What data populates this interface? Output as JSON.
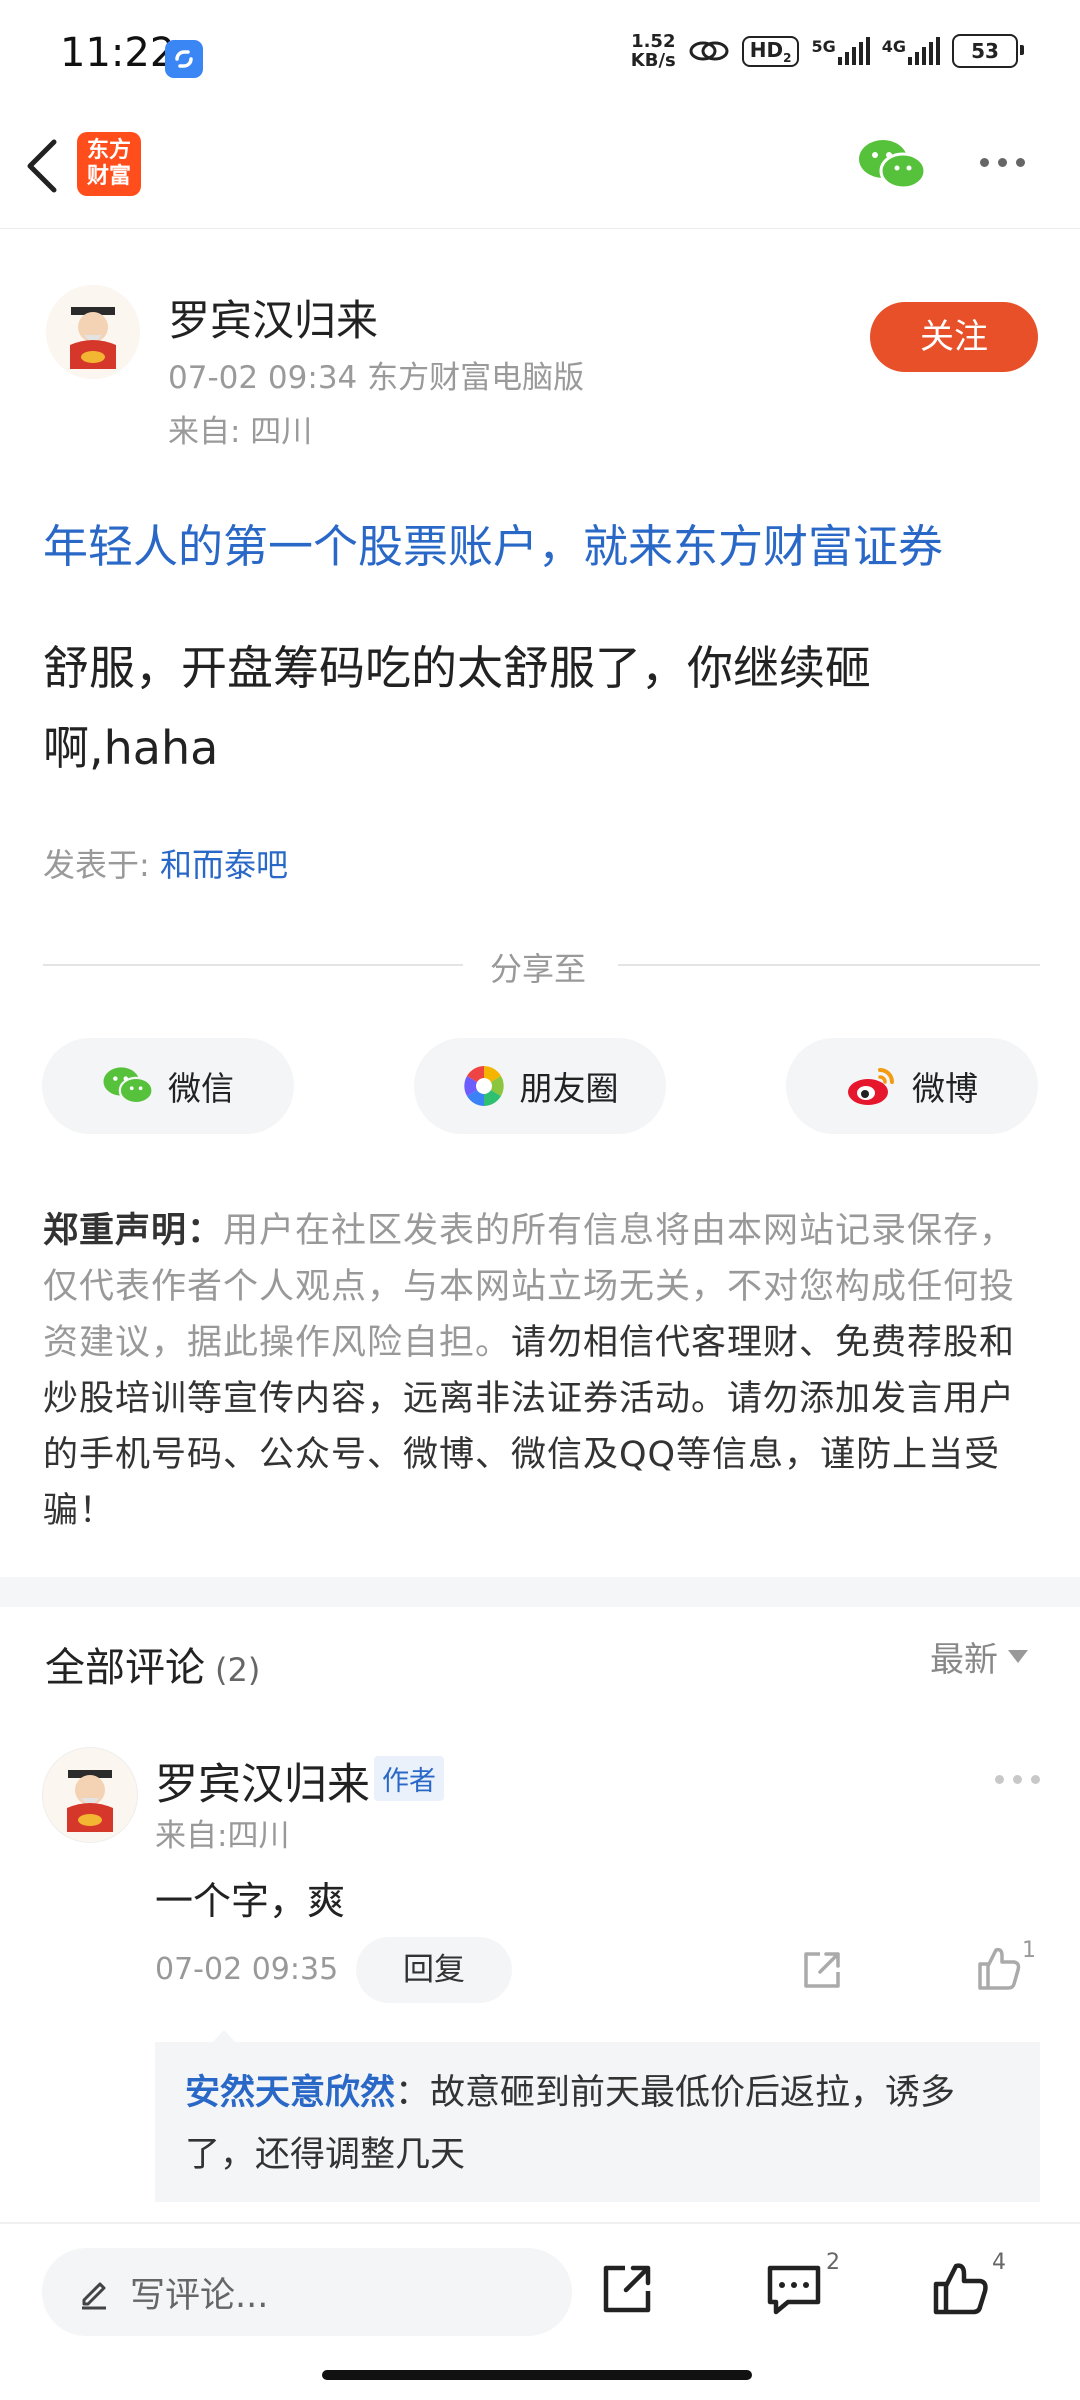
{
  "status_bar": {
    "time": "11:22",
    "net_speed_value": "1.52",
    "net_speed_unit": "KB/s",
    "hd_label": "HD",
    "hd_sub": "2",
    "signal_5g": "5G",
    "signal_4g": "4G",
    "battery": "53"
  },
  "nav": {
    "logo_line1": "东方",
    "logo_line2": "财富"
  },
  "post": {
    "author_name": "罗宾汉归来",
    "meta": "07-02 09:34 东方财富电脑版",
    "from": "来自: 四川",
    "follow_label": "关注",
    "ad_text": "年轻人的第一个股票账户，就来东方财富证券",
    "body_line1": "舒服，开盘筹码吃的太舒服了，你继续砸",
    "body_line2": "啊,haha",
    "posted_in_label": "发表于: ",
    "posted_in_link": "和而泰吧"
  },
  "share": {
    "label": "分享至",
    "wechat": "微信",
    "moments": "朋友圈",
    "weibo": "微博"
  },
  "disclaimer": {
    "title": "郑重声明：",
    "text": "用户在社区发表的所有信息将由本网站记录保存，仅代表作者个人观点，与本网站立场无关，不对您构成任何投资建议，据此操作风险自担。",
    "strong": "请勿相信代客理财、免费荐股和炒股培训等宣传内容，远离非法证券活动。请勿添加发言用户的手机号码、公众号、微博、微信及QQ等信息，谨防上当受骗！"
  },
  "comments": {
    "title": "全部评论",
    "count": "(2)",
    "sort": "最新",
    "items": [
      {
        "name": "罗宾汉归来",
        "tag": "作者",
        "from": "来自:四川",
        "text": "一个字，爽",
        "time": "07-02 09:35",
        "reply_label": "回复",
        "likes": "1",
        "reply": {
          "user": "安然天意欣然",
          "text": "：故意砸到前天最低价后返拉，诱多了，还得调整几天"
        }
      }
    ]
  },
  "bottom_bar": {
    "write_placeholder": "写评论...",
    "comment_count": "2",
    "like_count": "4"
  },
  "colors": {
    "accent_blue": "#2a68c7",
    "follow_orange": "#e8502a",
    "logo_orange": "#ff4e1b"
  }
}
